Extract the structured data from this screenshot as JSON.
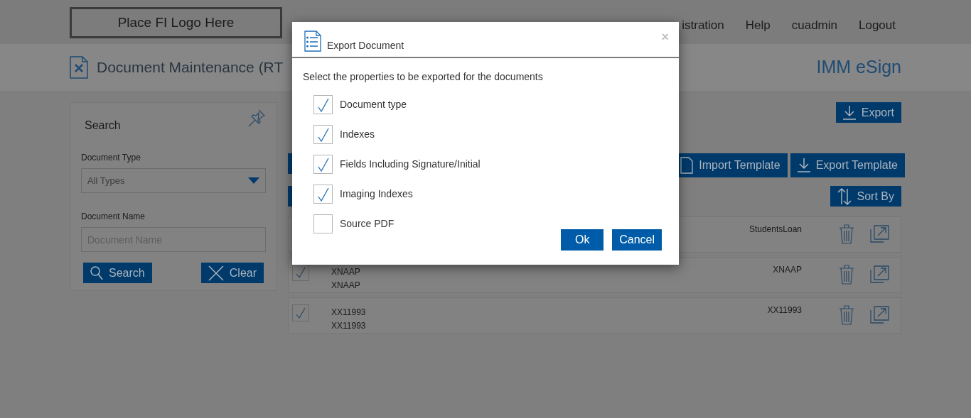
{
  "header": {
    "logo": "Place FI Logo Here",
    "nav": [
      {
        "label": "istration"
      },
      {
        "label": "Help"
      },
      {
        "label": "cuadmin"
      },
      {
        "label": "Logout"
      }
    ]
  },
  "page": {
    "title": "Document Maintenance (RT",
    "brand": "IMM eSign"
  },
  "search_panel": {
    "title": "Search",
    "document_type": {
      "label": "Document Type",
      "value": "All Types"
    },
    "document_name": {
      "label": "Document Name",
      "placeholder": "Document Name"
    },
    "buttons": [
      {
        "kind": "search",
        "label": "Search"
      },
      {
        "kind": "clear",
        "label": "Clear"
      }
    ]
  },
  "toolbar": {
    "export": "Export",
    "import_template": "Import Template",
    "export_template": "Export Template",
    "sort_by": "Sort By"
  },
  "documents": [
    {
      "type": "StudentsLoan"
    },
    {
      "checked": true,
      "name": "XNAAP",
      "description": "XNAAP",
      "type": "XNAAP"
    },
    {
      "checked": true,
      "name": "XX11993",
      "description": "XX11993",
      "type": "XX11993"
    }
  ],
  "dialog": {
    "title": "Export Document",
    "close": "×",
    "prompt": "Select the properties to be exported for the documents",
    "options": [
      {
        "label": "Document type",
        "checked": true
      },
      {
        "label": "Indexes",
        "checked": true
      },
      {
        "label": "Fields Including Signature/Initial",
        "checked": true
      },
      {
        "label": "Imaging Indexes",
        "checked": true
      },
      {
        "label": "Source PDF",
        "checked": false
      }
    ],
    "buttons": [
      "Ok",
      "Cancel"
    ]
  }
}
